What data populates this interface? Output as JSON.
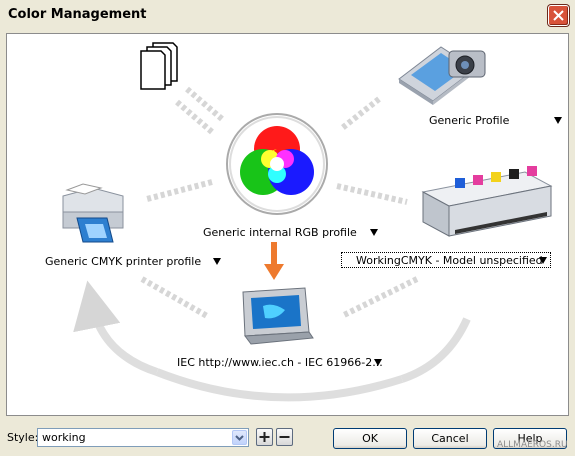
{
  "window": {
    "title": "Color Management"
  },
  "profiles": {
    "source": "Generic Profile",
    "internal": "Generic internal RGB profile",
    "printer": "Generic CMYK printer profile",
    "separation": "WorkingCMYK - Model unspecified",
    "monitor": "IEC http://www.iec.ch - IEC 61966-2..."
  },
  "style": {
    "label": "Style:",
    "value": "working"
  },
  "buttons": {
    "ok": "OK",
    "cancel": "Cancel",
    "help": "Help"
  },
  "watermark": "ALLMAEROS.RU",
  "colors": {
    "flow_arrow": "#d0d0d0",
    "active_arrow": "#ee7a2e",
    "red": "#ff1a1a",
    "green": "#18c418",
    "blue": "#1a1aff"
  },
  "icons": [
    "documents-icon",
    "scanner-camera-icon",
    "color-wheel-icon",
    "printer-icon",
    "press-icon",
    "monitor-icon"
  ]
}
